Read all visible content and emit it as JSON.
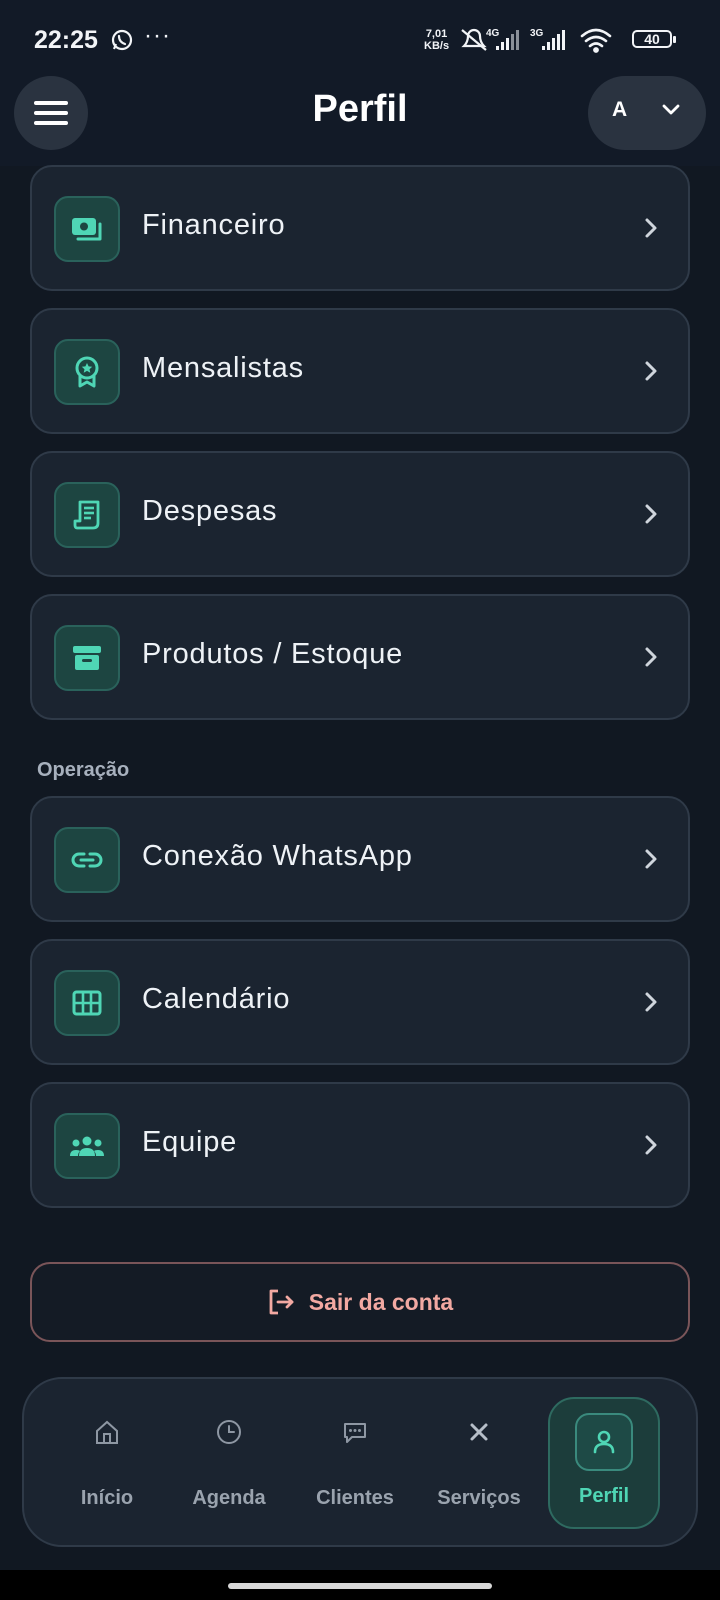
{
  "status_bar": {
    "time": "22:25",
    "more": "···",
    "net_speed_value": "7,01",
    "net_speed_unit": "KB/s",
    "net1": "4G",
    "net2": "3G",
    "battery": "40"
  },
  "header": {
    "title": "Perfil",
    "avatar_initial": "A"
  },
  "menu": {
    "items": [
      {
        "label": "Financeiro",
        "icon": "money-icon"
      },
      {
        "label": "Mensalistas",
        "icon": "badge-icon"
      },
      {
        "label": "Despesas",
        "icon": "receipt-icon"
      },
      {
        "label": "Produtos / Estoque",
        "icon": "archive-box-icon"
      }
    ],
    "section_title": "Operação",
    "operation_items": [
      {
        "label": "Conexão WhatsApp",
        "icon": "link-icon"
      },
      {
        "label": "Calendário",
        "icon": "calendar-grid-icon"
      },
      {
        "label": "Equipe",
        "icon": "team-icon"
      }
    ]
  },
  "logout": {
    "label": "Sair da conta"
  },
  "bottom_nav": {
    "items": [
      {
        "label": "Início",
        "icon": "home-icon"
      },
      {
        "label": "Agenda",
        "icon": "clock-icon"
      },
      {
        "label": "Clientes",
        "icon": "chat-icon"
      },
      {
        "label": "Serviços",
        "icon": "tools-icon"
      },
      {
        "label": "Perfil",
        "icon": "user-icon",
        "active": true
      }
    ]
  },
  "colors": {
    "background": "#111822",
    "card": "#1b2430",
    "accent": "#4fd6b5",
    "logout_text": "#f2a9a2"
  }
}
